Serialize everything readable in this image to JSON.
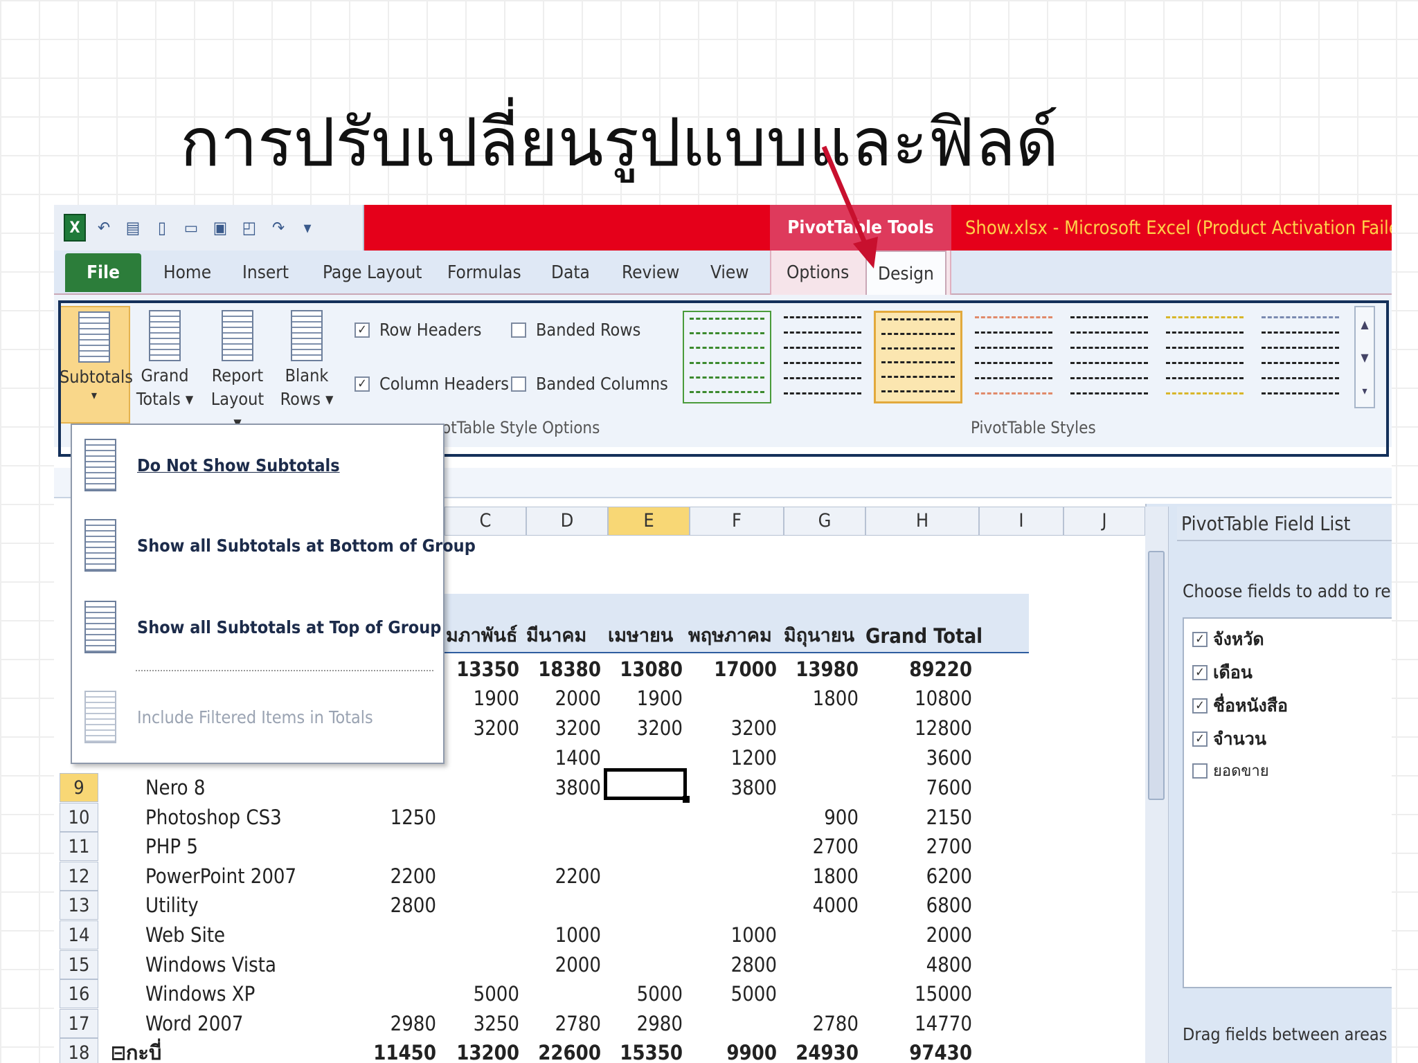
{
  "slide_title": "การปรับเปลี่ยนรูปแบบและฟิลด์",
  "window": {
    "context_tools": "PivotTable Tools",
    "title": "Show.xlsx - Microsoft Excel (Product Activation Failed)"
  },
  "tabs": [
    "File",
    "Home",
    "Insert",
    "Page Layout",
    "Formulas",
    "Data",
    "Review",
    "View",
    "Options",
    "Design"
  ],
  "ribbon": {
    "subtotals": "Subtotals",
    "grand_totals_1": "Grand",
    "grand_totals_2": "Totals ▾",
    "report_layout_1": "Report",
    "report_layout_2": "Layout ▾",
    "blank_rows_1": "Blank",
    "blank_rows_2": "Rows ▾",
    "row_headers": "Row Headers",
    "banded_rows": "Banded Rows",
    "column_headers": "Column Headers",
    "banded_columns": "Banded Columns",
    "style_options_label": "otTable Style Options",
    "styles_label": "PivotTable Styles",
    "dropdown_arrow": "▾"
  },
  "subtotals_menu": [
    "Do Not Show Subtotals",
    "Show all Subtotals at Bottom of Group",
    "Show all Subtotals at Top of Group",
    "Include Filtered Items in Totals"
  ],
  "columns": [
    "C",
    "D",
    "E",
    "F",
    "G",
    "H",
    "I",
    "J"
  ],
  "pivot_headers": [
    "มภาพันธ์",
    "มีนาคม",
    "เมษายน",
    "พฤษภาคม",
    "มิถุนายน",
    "Grand Total"
  ],
  "row_group_total": [
    "13350",
    "18380",
    "13080",
    "17000",
    "13980",
    "89220"
  ],
  "rows_partial": [
    {
      "vals": [
        "1900",
        "2000",
        "1900",
        "",
        "1800",
        "10800"
      ]
    },
    {
      "vals": [
        "3200",
        "3200",
        "3200",
        "3200",
        "",
        "12800"
      ]
    },
    {
      "vals": [
        "",
        "1400",
        "",
        "1200",
        "",
        "3600"
      ]
    }
  ],
  "rows": [
    {
      "num": "9",
      "label": "Nero 8",
      "b": "",
      "vals": [
        "",
        "3800",
        "",
        "3800",
        "",
        "7600"
      ]
    },
    {
      "num": "10",
      "label": "Photoshop CS3",
      "b": "1250",
      "vals": [
        "",
        "",
        "",
        "",
        "900",
        "2150"
      ]
    },
    {
      "num": "11",
      "label": "PHP 5",
      "b": "",
      "vals": [
        "",
        "",
        "",
        "",
        "2700",
        "2700"
      ]
    },
    {
      "num": "12",
      "label": "PowerPoint 2007",
      "b": "2200",
      "vals": [
        "",
        "2200",
        "",
        "",
        "1800",
        "6200"
      ]
    },
    {
      "num": "13",
      "label": "Utility",
      "b": "2800",
      "vals": [
        "",
        "",
        "",
        "",
        "4000",
        "6800"
      ]
    },
    {
      "num": "14",
      "label": "Web Site",
      "b": "",
      "vals": [
        "",
        "1000",
        "",
        "1000",
        "",
        "2000"
      ]
    },
    {
      "num": "15",
      "label": "Windows Vista",
      "b": "",
      "vals": [
        "",
        "2000",
        "",
        "2800",
        "",
        "4800"
      ]
    },
    {
      "num": "16",
      "label": "Windows XP",
      "b": "",
      "vals": [
        "5000",
        "",
        "5000",
        "5000",
        "",
        "15000"
      ]
    },
    {
      "num": "17",
      "label": "Word 2007",
      "b": "2980",
      "vals": [
        "3250",
        "2780",
        "2980",
        "",
        "2780",
        "14770"
      ]
    },
    {
      "num": "18",
      "label": "⊟กะบี่",
      "b": "11450",
      "vals": [
        "13200",
        "22600",
        "15350",
        "9900",
        "24930",
        "97430"
      ],
      "bold": true
    }
  ],
  "field_list": {
    "title": "PivotTable Field List",
    "choose": "Choose fields to add to report:",
    "fields": [
      {
        "name": "จังหวัด",
        "checked": true
      },
      {
        "name": "เดือน",
        "checked": true
      },
      {
        "name": "ชื่อหนังสือ",
        "checked": true
      },
      {
        "name": "จำนวน",
        "checked": true
      },
      {
        "name": "ยอดขาย",
        "checked": false
      }
    ],
    "drag_hint": "Drag fields between areas belo",
    "checkmark": "✓"
  },
  "colors": {
    "titlebar": "#e5001a",
    "context": "#de3a5c",
    "file_tab": "#2c7d3a",
    "arrow": "#c8102e"
  }
}
